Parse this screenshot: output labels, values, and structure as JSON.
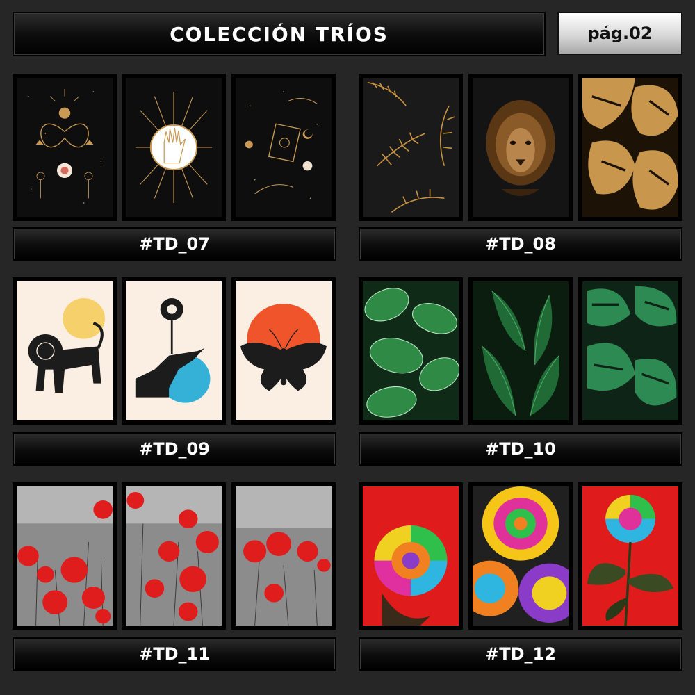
{
  "header": {
    "title": "COLECCIÓN TRÍOS",
    "page": "pág.02"
  },
  "collections": [
    {
      "code": "#TD_07",
      "prints": [
        "moth-eye-print",
        "sun-hand-print",
        "tarot-hands-print"
      ]
    },
    {
      "code": "#TD_08",
      "prints": [
        "golden-palm-print",
        "lion-print",
        "golden-monstera-print"
      ]
    },
    {
      "code": "#TD_09",
      "prints": [
        "lion-boho-print",
        "hand-flower-print",
        "moth-sun-print"
      ]
    },
    {
      "code": "#TD_10",
      "prints": [
        "calathea-leaves-print",
        "banana-leaves-print",
        "monstera-leaves-print"
      ]
    },
    {
      "code": "#TD_11",
      "prints": [
        "red-poppies-print-1",
        "red-poppies-print-2",
        "red-poppies-print-3"
      ]
    },
    {
      "code": "#TD_12",
      "prints": [
        "rainbow-rose-print-1",
        "rainbow-roses-print-2",
        "rainbow-rose-print-3"
      ]
    }
  ],
  "colors": {
    "background": "#262626",
    "gold": "#c89a55",
    "cream": "#fbeee2",
    "orange": "#f0542a",
    "yellow": "#f6d06a",
    "blue": "#35b0d6",
    "poppy": "#e01d1d",
    "rose_bg": "#e01b1b"
  }
}
